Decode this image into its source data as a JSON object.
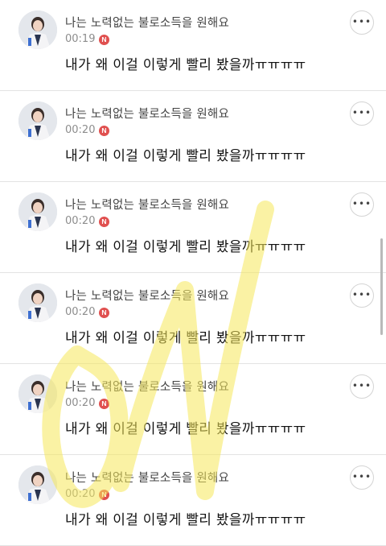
{
  "posts": [
    {
      "nickname": "나는 노력없는 불로소득을 원해요",
      "time": "00:19",
      "badge": "N",
      "message": "내가 왜 이걸 이렇게 빨리 봤을까ㅠㅠㅠㅠ",
      "more_icon": "ellipsis-icon"
    },
    {
      "nickname": "나는 노력없는 불로소득을 원해요",
      "time": "00:20",
      "badge": "N",
      "message": "내가 왜 이걸 이렇게 빨리 봤을까ㅠㅠㅠㅠ",
      "more_icon": "ellipsis-icon"
    },
    {
      "nickname": "나는 노력없는 불로소득을 원해요",
      "time": "00:20",
      "badge": "N",
      "message": "내가 왜 이걸 이렇게 빨리 봤을까ㅠㅠㅠㅠ",
      "more_icon": "ellipsis-icon"
    },
    {
      "nickname": "나는 노력없는 불로소득을 원해요",
      "time": "00:20",
      "badge": "N",
      "message": "내가 왜 이걸 이렇게 빨리 봤을까ㅠㅠㅠㅠ",
      "more_icon": "ellipsis-icon"
    },
    {
      "nickname": "나는 노력없는 불로소득을 원해요",
      "time": "00:20",
      "badge": "N",
      "message": "내가 왜 이걸 이렇게 빨리 봤을까ㅠㅠㅠㅠ",
      "more_icon": "ellipsis-icon"
    },
    {
      "nickname": "나는 노력없는 불로소득을 원해요",
      "time": "00:20",
      "badge": "N",
      "message": "내가 왜 이걸 이렇게 빨리 봤을까ㅠㅠㅠㅠ",
      "more_icon": "ellipsis-icon"
    }
  ],
  "colors": {
    "badge": "#e0504f",
    "watermark": "#f6e85a",
    "divider": "#e3e3e3"
  }
}
